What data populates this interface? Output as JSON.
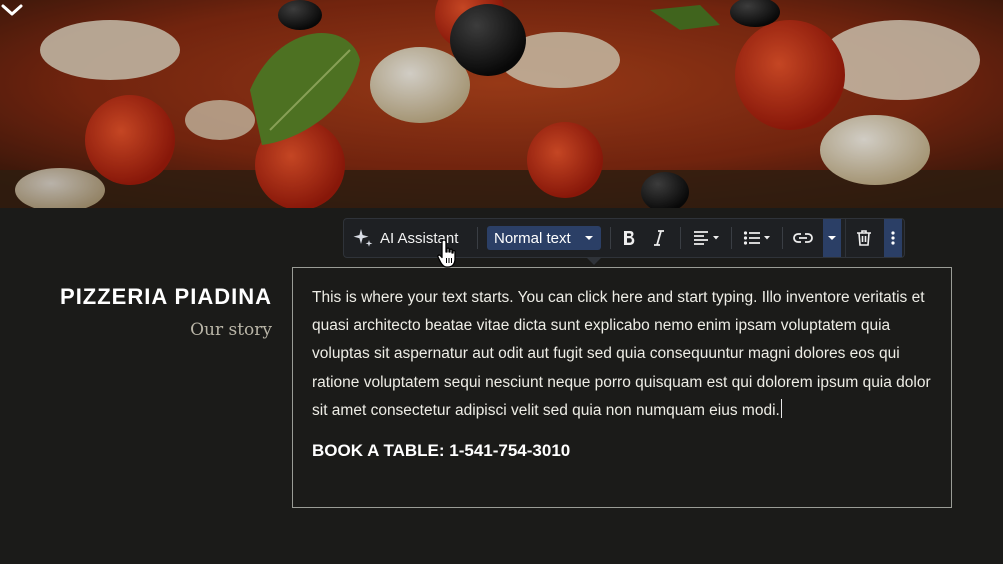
{
  "hero": {
    "scroll_icon": "chevron-down-icon"
  },
  "brand": {
    "title": "PIZZERIA PIADINA",
    "subtitle": "Our story"
  },
  "toolbar": {
    "ai_label": "AI Assistant",
    "ai_icon": "sparkle-icon",
    "text_style": "Normal text",
    "bold_icon": "bold-icon",
    "italic_icon": "italic-icon",
    "align_icon": "align-left-icon",
    "list_icon": "bullet-list-icon",
    "link_icon": "link-icon",
    "delete_icon": "trash-icon",
    "more_icon": "more-vertical-icon",
    "accent": "#2b3f66"
  },
  "editor": {
    "body": "This is where your text starts. You can click here and start typing. Illo inventore veritatis et quasi architecto beatae vitae dicta sunt explicabo nemo enim ipsam voluptatem quia voluptas sit aspernatur aut odit aut fugit sed quia consequuntur magni dolores eos qui ratione voluptatem sequi nesciunt neque porro quisquam est qui dolorem ipsum quia dolor sit amet consectetur adipisci velit sed quia non numquam eius modi.",
    "cta": "BOOK A TABLE: 1-541-754-3010"
  }
}
